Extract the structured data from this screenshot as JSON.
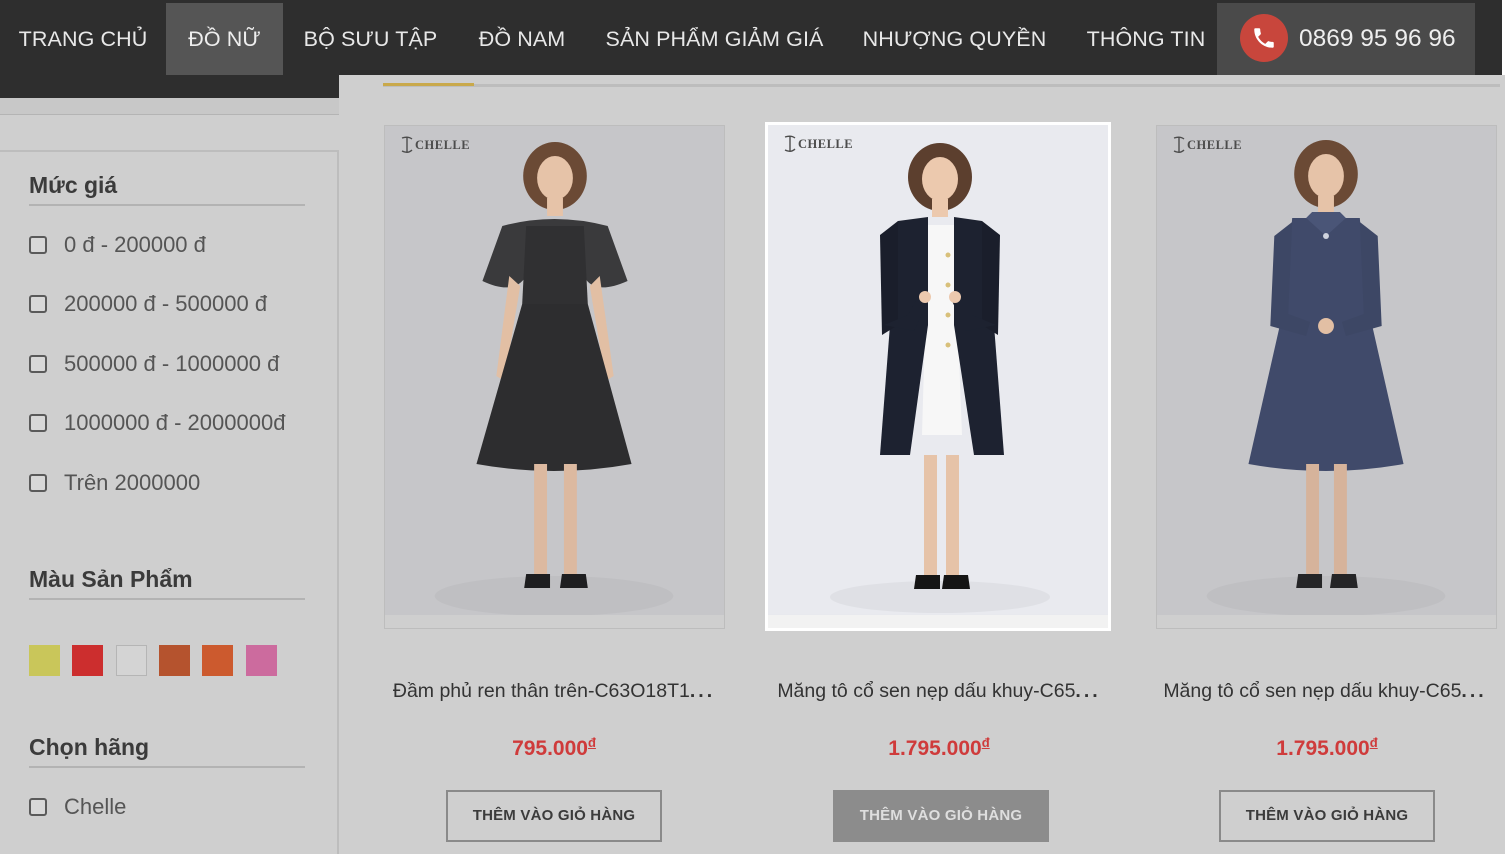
{
  "nav": {
    "items": [
      {
        "label": "TRANG CHỦ",
        "active": false
      },
      {
        "label": "ĐỒ NỮ",
        "active": true
      },
      {
        "label": "BỘ SƯU TẬP",
        "active": false
      },
      {
        "label": "ĐỒ NAM",
        "active": false
      },
      {
        "label": "SẢN PHẨM GIẢM GIÁ",
        "active": false
      },
      {
        "label": "NHƯỢNG QUYỀN",
        "active": false
      },
      {
        "label": "THÔNG TIN",
        "active": false
      }
    ],
    "phone": "0869 95 96 96"
  },
  "sidebar": {
    "price_heading": "Mức giá",
    "price_options": [
      "0 đ - 200000 đ",
      "200000 đ - 500000 đ",
      "500000 đ - 1000000 đ",
      "1000000 đ - 2000000đ",
      "Trên 2000000"
    ],
    "color_heading": "Màu Sản Phẩm",
    "colors": [
      "#c9c65a",
      "#cc2e2e",
      "#d4d4d4",
      "#b5532e",
      "#cc5a2e",
      "#cc6b9e"
    ],
    "brand_heading": "Chọn hãng",
    "brands": [
      "Chelle"
    ]
  },
  "products": [
    {
      "logo": "CHELLE",
      "title": "Đầm phủ ren thân trên-C63O18T1",
      "ellipsis": "...",
      "price": "795.000",
      "currency": "đ",
      "button": "THÊM VÀO GIỎ HÀNG"
    },
    {
      "logo": "CHELLE",
      "title": "Măng tô cổ sen nẹp dấu khuy-C65",
      "ellipsis": "...",
      "price": "1.795.000",
      "currency": "đ",
      "button": "THÊM VÀO GIỎ HÀNG"
    },
    {
      "logo": "CHELLE",
      "title": "Măng tô cổ sen nẹp dấu khuy-C65",
      "ellipsis": "...",
      "price": "1.795.000",
      "currency": "đ",
      "button": "THÊM VÀO GIỎ HÀNG"
    }
  ]
}
